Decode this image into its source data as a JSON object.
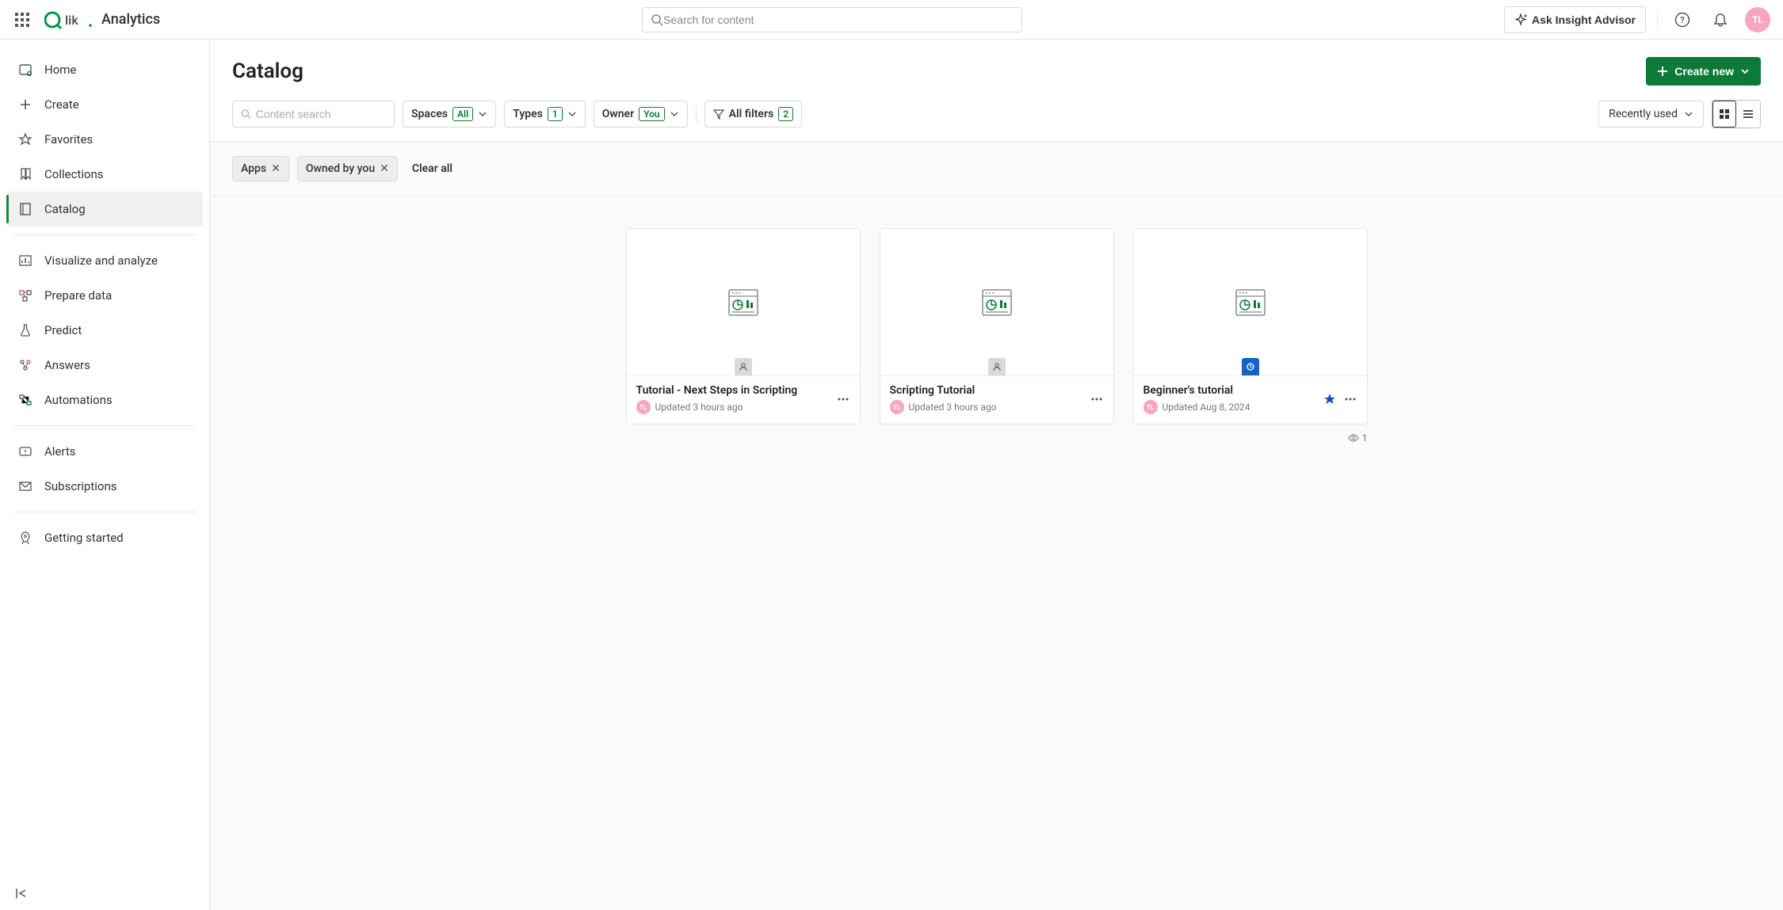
{
  "header": {
    "product": "Analytics",
    "search_placeholder": "Search for content",
    "insight_label": "Ask Insight Advisor",
    "avatar_initials": "TL"
  },
  "sidebar": {
    "items": [
      {
        "label": "Home"
      },
      {
        "label": "Create"
      },
      {
        "label": "Favorites"
      },
      {
        "label": "Collections"
      },
      {
        "label": "Catalog"
      },
      {
        "label": "Visualize and analyze"
      },
      {
        "label": "Prepare data"
      },
      {
        "label": "Predict"
      },
      {
        "label": "Answers"
      },
      {
        "label": "Automations"
      },
      {
        "label": "Alerts"
      },
      {
        "label": "Subscriptions"
      },
      {
        "label": "Getting started"
      }
    ]
  },
  "page": {
    "title": "Catalog",
    "create_label": "Create new",
    "content_search_placeholder": "Content search",
    "filters": {
      "spaces_label": "Spaces",
      "spaces_badge": "All",
      "types_label": "Types",
      "types_badge": "1",
      "owner_label": "Owner",
      "owner_badge": "You",
      "allfilters_label": "All filters",
      "allfilters_badge": "2"
    },
    "sort_label": "Recently used",
    "chips": [
      {
        "label": "Apps"
      },
      {
        "label": "Owned by you"
      }
    ],
    "clear_all": "Clear all"
  },
  "cards": [
    {
      "title": "Tutorial - Next Steps in Scripting",
      "meta": "Updated 3 hours ago",
      "avatar": "TL",
      "favorite": false,
      "space": "personal"
    },
    {
      "title": "Scripting Tutorial",
      "meta": "Updated 3 hours ago",
      "avatar": "TL",
      "favorite": false,
      "space": "personal"
    },
    {
      "title": "Beginner's tutorial",
      "meta": "Updated Aug 8, 2024",
      "avatar": "TL",
      "favorite": true,
      "space": "shared"
    }
  ],
  "view_count": "1"
}
